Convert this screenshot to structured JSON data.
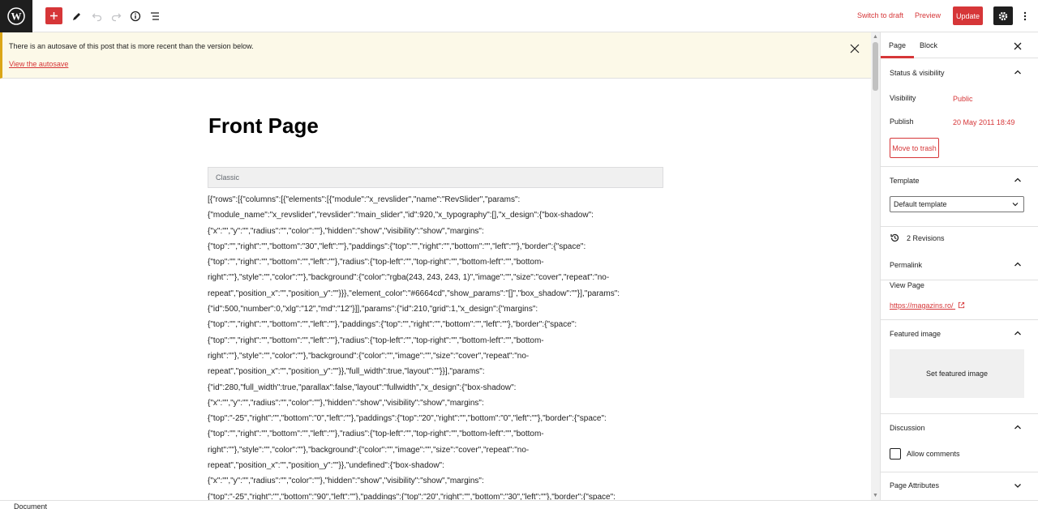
{
  "toolbar": {
    "add_block": "add-block",
    "switch_to_draft": "Switch to draft",
    "preview": "Preview",
    "update": "Update"
  },
  "notice": {
    "text": "There is an autosave of this post that is more recent than the version below.",
    "link": "View the autosave"
  },
  "editor": {
    "title": "Front Page",
    "classic_label": "Classic",
    "content_lines": [
      "[{\"rows\":[{\"columns\":[{\"elements\":[{\"module\":\"x_revslider\",\"name\":\"RevSlider\",\"params\":",
      "{\"module_name\":\"x_revslider\",\"revslider\":\"main_slider\",\"id\":920,\"x_typography\":[],\"x_design\":{\"box-shadow\":",
      "{\"x\":\"\",\"y\":\"\",\"radius\":\"\",\"color\":\"\"},\"hidden\":\"show\",\"visibility\":\"show\",\"margins\":",
      "{\"top\":\"\",\"right\":\"\",\"bottom\":\"30\",\"left\":\"\"},\"paddings\":{\"top\":\"\",\"right\":\"\",\"bottom\":\"\",\"left\":\"\"},\"border\":{\"space\":",
      "{\"top\":\"\",\"right\":\"\",\"bottom\":\"\",\"left\":\"\"},\"radius\":{\"top-left\":\"\",\"top-right\":\"\",\"bottom-left\":\"\",\"bottom-",
      "right\":\"\"},\"style\":\"\",\"color\":\"\"},\"background\":{\"color\":\"rgba(243, 243, 243, 1)\",\"image\":\"\",\"size\":\"cover\",\"repeat\":\"no-",
      "repeat\",\"position_x\":\"\",\"position_y\":\"\"}}},\"element_color\":\"#6664cd\",\"show_params\":\"[]\",\"box_shadow\":\"\"}],\"params\":",
      "{\"id\":500,\"number\":0,\"xlg\":\"12\",\"md\":\"12\"}]],\"params\":{\"id\":210,\"grid\":1,\"x_design\":{\"margins\":",
      "{\"top\":\"\",\"right\":\"\",\"bottom\":\"\",\"left\":\"\"},\"paddings\":{\"top\":\"\",\"right\":\"\",\"bottom\":\"\",\"left\":\"\"},\"border\":{\"space\":",
      "{\"top\":\"\",\"right\":\"\",\"bottom\":\"\",\"left\":\"\"},\"radius\":{\"top-left\":\"\",\"top-right\":\"\",\"bottom-left\":\"\",\"bottom-",
      "right\":\"\"},\"style\":\"\",\"color\":\"\"},\"background\":{\"color\":\"\",\"image\":\"\",\"size\":\"cover\",\"repeat\":\"no-",
      "repeat\",\"position_x\":\"\",\"position_y\":\"\"}},\"full_width\":true,\"layout\":\"\"}}],\"params\":",
      "{\"id\":280,\"full_width\":true,\"parallax\":false,\"layout\":\"fullwidth\",\"x_design\":{\"box-shadow\":",
      "{\"x\":\"\",\"y\":\"\",\"radius\":\"\",\"color\":\"\"},\"hidden\":\"show\",\"visibility\":\"show\",\"margins\":",
      "{\"top\":\"-25\",\"right\":\"\",\"bottom\":\"0\",\"left\":\"\"},\"paddings\":{\"top\":\"20\",\"right\":\"\",\"bottom\":\"0\",\"left\":\"\"},\"border\":{\"space\":",
      "{\"top\":\"\",\"right\":\"\",\"bottom\":\"\",\"left\":\"\"},\"radius\":{\"top-left\":\"\",\"top-right\":\"\",\"bottom-left\":\"\",\"bottom-",
      "right\":\"\"},\"style\":\"\",\"color\":\"\"},\"background\":{\"color\":\"\",\"image\":\"\",\"size\":\"cover\",\"repeat\":\"no-",
      "repeat\",\"position_x\":\"\",\"position_y\":\"\"}},\"undefined\":{\"box-shadow\":",
      "{\"x\":\"\",\"y\":\"\",\"radius\":\"\",\"color\":\"\"},\"hidden\":\"show\",\"visibility\":\"show\",\"margins\":",
      "{\"top\":\"-25\",\"right\":\"\",\"bottom\":\"90\",\"left\":\"\"},\"paddings\":{\"top\":\"20\",\"right\":\"\",\"bottom\":\"30\",\"left\":\"\"},\"border\":{\"space\":"
    ]
  },
  "sidebar": {
    "tabs": [
      "Page",
      "Block"
    ],
    "status": {
      "title": "Status & visibility",
      "visibility_label": "Visibility",
      "visibility_value": "Public",
      "publish_label": "Publish",
      "publish_value": "20 May 2011 18:49",
      "trash": "Move to trash"
    },
    "template": {
      "title": "Template",
      "selected": "Default template"
    },
    "revisions": "2 Revisions",
    "permalink": {
      "title": "Permalink",
      "view_label": "View Page",
      "url": "https://magazins.ro/"
    },
    "featured": {
      "title": "Featured image",
      "button": "Set featured image"
    },
    "discussion": {
      "title": "Discussion",
      "allow_comments": "Allow comments"
    },
    "page_attributes": "Page Attributes"
  },
  "footer": {
    "breadcrumb": "Document"
  },
  "colors": {
    "accent": "#d63638",
    "dark": "#1e1e1e"
  }
}
